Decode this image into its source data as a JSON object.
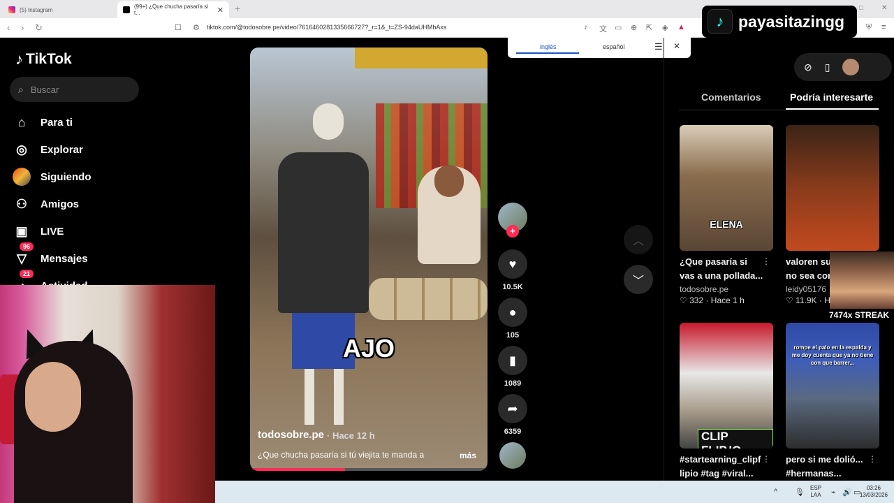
{
  "browser": {
    "tabs": [
      {
        "title": "(5) Instagram"
      },
      {
        "title": "(99+) ¿Que chucha pasaría si t..."
      }
    ],
    "url": "tiktok.com/@todosobre.pe/video/7616460281335666727?_r=1&_t=ZS-94daUHMhAxs"
  },
  "translate_popup": {
    "lang_from": "inglés",
    "lang_to": "español"
  },
  "sidebar": {
    "logo": "TikTok",
    "search_placeholder": "Buscar",
    "items": [
      {
        "label": "Para ti",
        "icon": "home-icon"
      },
      {
        "label": "Explorar",
        "icon": "compass-icon"
      },
      {
        "label": "Siguiendo",
        "icon": "following-icon"
      },
      {
        "label": "Amigos",
        "icon": "friends-icon"
      },
      {
        "label": "LIVE",
        "icon": "live-icon"
      },
      {
        "label": "Mensajes",
        "icon": "messages-icon",
        "badge": "96"
      },
      {
        "label": "Actividad",
        "icon": "activity-icon",
        "badge": "21"
      }
    ]
  },
  "video": {
    "overlay_text": "AJO",
    "author": "todosobre.pe",
    "time": "· Hace 12 h",
    "caption": "¿Que chucha pasaría si tú viejita te manda a",
    "more": "más",
    "progress": 0.4
  },
  "actions": {
    "likes": "10.5K",
    "comments": "105",
    "saves": "1089",
    "shares": "6359"
  },
  "right_panel": {
    "tabs": [
      "Comentarios",
      "Podría interesarte"
    ],
    "cards": [
      {
        "title_line1": "¿Que pasaría si",
        "title_line2": "vas a una pollada...",
        "author": "todosobre.pe",
        "likes": "332",
        "time": "Hace 1 h",
        "thumb_text": "ELENA"
      },
      {
        "title_line1": "valoren su",
        "title_line2": "no sea com",
        "author": "leidy05176",
        "likes": "11.9K",
        "time": "H",
        "thumb_text": ""
      },
      {
        "title_line1": "#startearning_clipf",
        "title_line2": "lipio #tag #viral...",
        "author": "",
        "likes": "",
        "time": "",
        "thumb_text": "CLIP FLIP.IO"
      },
      {
        "title_line1": "pero si me dolió...",
        "title_line2": "#hermanas...",
        "author": "",
        "likes": "",
        "time": "",
        "thumb_text": "rompe el palo en la espalda y me doy cuenta que ya no tiene con que barrer..."
      }
    ]
  },
  "overlays": {
    "username": "payasitazingg",
    "streak": "7474x STREAK"
  },
  "taskbar": {
    "lang1": "ESP",
    "lang2": "LAA",
    "time": "03:26",
    "date": "13/03/2026"
  },
  "colors": {
    "accent": "#fe2c55",
    "background": "#000000",
    "taskbar": "#dce9f0"
  }
}
